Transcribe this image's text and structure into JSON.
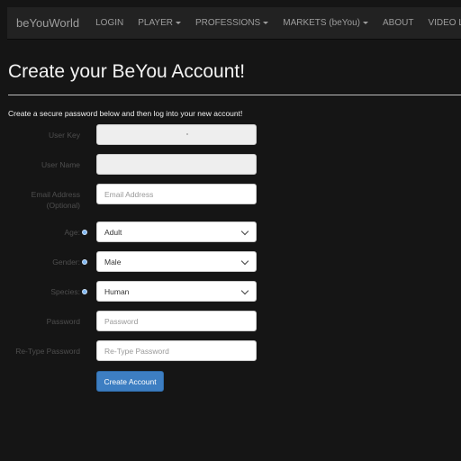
{
  "nav": {
    "brand": "beYouWorld",
    "items": [
      {
        "label": "LOGIN",
        "dropdown": false
      },
      {
        "label": "PLAYER",
        "dropdown": true
      },
      {
        "label": "PROFESSIONS",
        "dropdown": true
      },
      {
        "label": "MARKETS (beYou)",
        "dropdown": true
      },
      {
        "label": "ABOUT",
        "dropdown": false
      },
      {
        "label": "VIDEO LIBRARY",
        "dropdown": false
      }
    ]
  },
  "page": {
    "title": "Create your BeYou Account!",
    "intro": "Create a secure password below and then log into your new account!"
  },
  "form": {
    "user_key": {
      "label": "User Key",
      "value": ""
    },
    "user_name": {
      "label": "User Name",
      "value": ""
    },
    "email": {
      "label_line1": "Email Address",
      "label_line2": "(Optional)",
      "placeholder": "Email Address"
    },
    "age": {
      "label": "Age:",
      "value": "Adult"
    },
    "gender": {
      "label": "Gender:",
      "value": "Male"
    },
    "species": {
      "label": "Species:",
      "value": "Human"
    },
    "password": {
      "label": "Password",
      "placeholder": "Password"
    },
    "retype_password": {
      "label": "Re-Type Password",
      "placeholder": "Re-Type Password"
    },
    "submit_label": "Create Account"
  },
  "colors": {
    "background": "#151515",
    "navbar": "#222222",
    "primary_button": "#3d7ec2",
    "info_dot": "#7fb6f0"
  }
}
